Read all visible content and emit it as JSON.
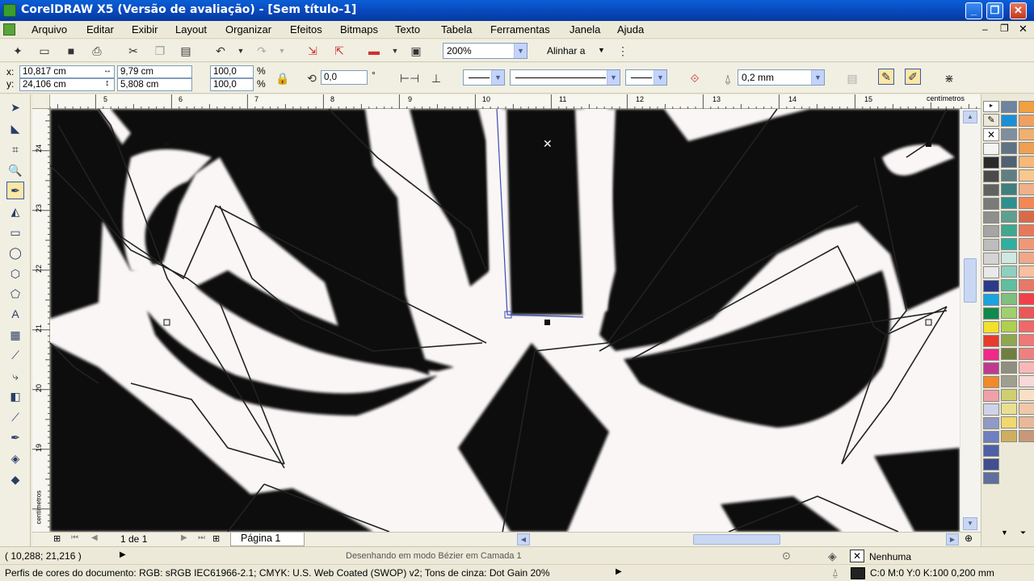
{
  "window": {
    "title": "CorelDRAW X5 (Versão de avaliação) - [Sem título-1]"
  },
  "menu": [
    "Arquivo",
    "Editar",
    "Exibir",
    "Layout",
    "Organizar",
    "Efeitos",
    "Bitmaps",
    "Texto",
    "Tabela",
    "Ferramentas",
    "Janela",
    "Ajuda"
  ],
  "toolbar": {
    "zoom_value": "200%",
    "align_label": "Alinhar a"
  },
  "properties": {
    "x_label": "x:",
    "x_value": "10,817 cm",
    "y_label": "y:",
    "y_value": "24,106 cm",
    "width_value": "9,79 cm",
    "height_value": "5,808 cm",
    "scale_x": "100,0",
    "scale_y": "100,0",
    "percent": "%",
    "rotation": "0,0",
    "degree": "°",
    "outline_width": "0,2 mm"
  },
  "ruler": {
    "h_ticks": [
      "5",
      "6",
      "7",
      "8",
      "9",
      "10",
      "11",
      "12",
      "13",
      "14",
      "15"
    ],
    "unit": "centímetros",
    "v_ticks": [
      "24",
      "23",
      "22",
      "21",
      "20",
      "19"
    ],
    "v_unit": "centímetros"
  },
  "page_nav": {
    "counter": "1 de 1",
    "page_tab": "Página 1"
  },
  "status": {
    "coords": "( 10,288; 21,216 )",
    "message": "Desenhando em modo Bézier em Camada 1",
    "fill_label": "Nenhuma",
    "color_profiles": "Perfis de cores do documento: RGB: sRGB IEC61966-2.1; CMYK: U.S. Web Coated (SWOP) v2; Tons de cinza: Dot Gain 20%",
    "outline_info": "C:0 M:0 Y:0 K:100  0,200 mm"
  },
  "palette_colors": [
    "#f4f4f4",
    "#2a2a2a",
    "#4a4a4a",
    "#626262",
    "#7a7a7a",
    "#8f8f8f",
    "#a5a5a5",
    "#bdbdbd",
    "#d3d3d3",
    "#e9e9e9",
    "#2b3b8a",
    "#19a3e0",
    "#0e8a4a",
    "#f2e02a",
    "#e83a2e",
    "#f0288a",
    "#bf3a8f",
    "#f08a2a",
    "#f2a0a8",
    "#cfd3ea",
    "#8f9ac6",
    "#6f7fbf",
    "#4f5fa8",
    "#3f4f8f",
    "#5f6f9f",
    "#6f849e",
    "#1a8fd6",
    "#7f8f9f",
    "#5f7385",
    "#4f6173",
    "#5f7f83",
    "#3f7f7f",
    "#2f8f8f",
    "#5f9f8f",
    "#3fa88f",
    "#2fafa0",
    "#cfe8e0",
    "#8fcfbf",
    "#5fbf9f",
    "#7fbf7f",
    "#9fcf6f",
    "#afcf4f",
    "#8fa84f",
    "#6f7f3f",
    "#8f8f7f",
    "#9f9f8f",
    "#cfcf6f",
    "#e8e08f",
    "#f0d86f",
    "#cfaf5f",
    "#f0a040",
    "#f0a060",
    "#f0b070",
    "#f0a050",
    "#f8b878",
    "#f8c890",
    "#f0b088",
    "#f08858",
    "#d86a4a",
    "#e8785a",
    "#f09878",
    "#f0a888",
    "#f8c0a0",
    "#e87868",
    "#f0404a",
    "#e85858",
    "#f06868",
    "#f07878",
    "#f08080",
    "#f8b8b8",
    "#f8d8d8",
    "#f8e0c8",
    "#f0c8a8",
    "#e8b898",
    "#c89878"
  ]
}
